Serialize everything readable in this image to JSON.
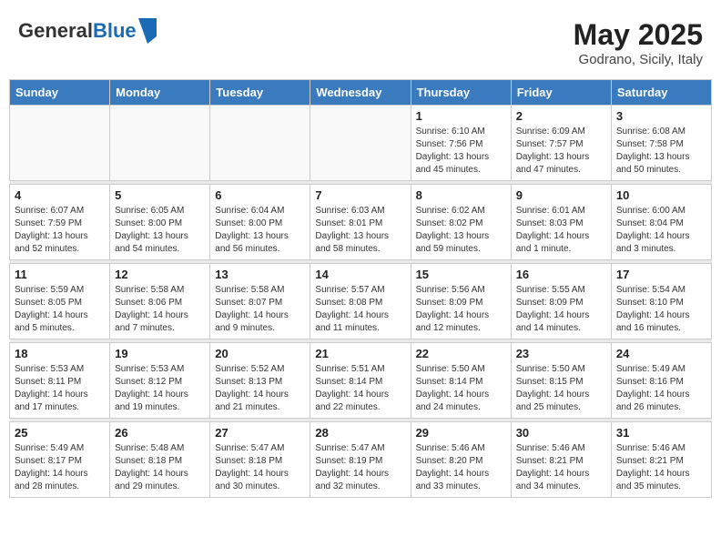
{
  "header": {
    "logo_general": "General",
    "logo_blue": "Blue",
    "month_title": "May 2025",
    "subtitle": "Godrano, Sicily, Italy"
  },
  "weekdays": [
    "Sunday",
    "Monday",
    "Tuesday",
    "Wednesday",
    "Thursday",
    "Friday",
    "Saturday"
  ],
  "weeks": [
    [
      {
        "day": "",
        "info": ""
      },
      {
        "day": "",
        "info": ""
      },
      {
        "day": "",
        "info": ""
      },
      {
        "day": "",
        "info": ""
      },
      {
        "day": "1",
        "info": "Sunrise: 6:10 AM\nSunset: 7:56 PM\nDaylight: 13 hours\nand 45 minutes."
      },
      {
        "day": "2",
        "info": "Sunrise: 6:09 AM\nSunset: 7:57 PM\nDaylight: 13 hours\nand 47 minutes."
      },
      {
        "day": "3",
        "info": "Sunrise: 6:08 AM\nSunset: 7:58 PM\nDaylight: 13 hours\nand 50 minutes."
      }
    ],
    [
      {
        "day": "4",
        "info": "Sunrise: 6:07 AM\nSunset: 7:59 PM\nDaylight: 13 hours\nand 52 minutes."
      },
      {
        "day": "5",
        "info": "Sunrise: 6:05 AM\nSunset: 8:00 PM\nDaylight: 13 hours\nand 54 minutes."
      },
      {
        "day": "6",
        "info": "Sunrise: 6:04 AM\nSunset: 8:00 PM\nDaylight: 13 hours\nand 56 minutes."
      },
      {
        "day": "7",
        "info": "Sunrise: 6:03 AM\nSunset: 8:01 PM\nDaylight: 13 hours\nand 58 minutes."
      },
      {
        "day": "8",
        "info": "Sunrise: 6:02 AM\nSunset: 8:02 PM\nDaylight: 13 hours\nand 59 minutes."
      },
      {
        "day": "9",
        "info": "Sunrise: 6:01 AM\nSunset: 8:03 PM\nDaylight: 14 hours\nand 1 minute."
      },
      {
        "day": "10",
        "info": "Sunrise: 6:00 AM\nSunset: 8:04 PM\nDaylight: 14 hours\nand 3 minutes."
      }
    ],
    [
      {
        "day": "11",
        "info": "Sunrise: 5:59 AM\nSunset: 8:05 PM\nDaylight: 14 hours\nand 5 minutes."
      },
      {
        "day": "12",
        "info": "Sunrise: 5:58 AM\nSunset: 8:06 PM\nDaylight: 14 hours\nand 7 minutes."
      },
      {
        "day": "13",
        "info": "Sunrise: 5:58 AM\nSunset: 8:07 PM\nDaylight: 14 hours\nand 9 minutes."
      },
      {
        "day": "14",
        "info": "Sunrise: 5:57 AM\nSunset: 8:08 PM\nDaylight: 14 hours\nand 11 minutes."
      },
      {
        "day": "15",
        "info": "Sunrise: 5:56 AM\nSunset: 8:09 PM\nDaylight: 14 hours\nand 12 minutes."
      },
      {
        "day": "16",
        "info": "Sunrise: 5:55 AM\nSunset: 8:09 PM\nDaylight: 14 hours\nand 14 minutes."
      },
      {
        "day": "17",
        "info": "Sunrise: 5:54 AM\nSunset: 8:10 PM\nDaylight: 14 hours\nand 16 minutes."
      }
    ],
    [
      {
        "day": "18",
        "info": "Sunrise: 5:53 AM\nSunset: 8:11 PM\nDaylight: 14 hours\nand 17 minutes."
      },
      {
        "day": "19",
        "info": "Sunrise: 5:53 AM\nSunset: 8:12 PM\nDaylight: 14 hours\nand 19 minutes."
      },
      {
        "day": "20",
        "info": "Sunrise: 5:52 AM\nSunset: 8:13 PM\nDaylight: 14 hours\nand 21 minutes."
      },
      {
        "day": "21",
        "info": "Sunrise: 5:51 AM\nSunset: 8:14 PM\nDaylight: 14 hours\nand 22 minutes."
      },
      {
        "day": "22",
        "info": "Sunrise: 5:50 AM\nSunset: 8:14 PM\nDaylight: 14 hours\nand 24 minutes."
      },
      {
        "day": "23",
        "info": "Sunrise: 5:50 AM\nSunset: 8:15 PM\nDaylight: 14 hours\nand 25 minutes."
      },
      {
        "day": "24",
        "info": "Sunrise: 5:49 AM\nSunset: 8:16 PM\nDaylight: 14 hours\nand 26 minutes."
      }
    ],
    [
      {
        "day": "25",
        "info": "Sunrise: 5:49 AM\nSunset: 8:17 PM\nDaylight: 14 hours\nand 28 minutes."
      },
      {
        "day": "26",
        "info": "Sunrise: 5:48 AM\nSunset: 8:18 PM\nDaylight: 14 hours\nand 29 minutes."
      },
      {
        "day": "27",
        "info": "Sunrise: 5:47 AM\nSunset: 8:18 PM\nDaylight: 14 hours\nand 30 minutes."
      },
      {
        "day": "28",
        "info": "Sunrise: 5:47 AM\nSunset: 8:19 PM\nDaylight: 14 hours\nand 32 minutes."
      },
      {
        "day": "29",
        "info": "Sunrise: 5:46 AM\nSunset: 8:20 PM\nDaylight: 14 hours\nand 33 minutes."
      },
      {
        "day": "30",
        "info": "Sunrise: 5:46 AM\nSunset: 8:21 PM\nDaylight: 14 hours\nand 34 minutes."
      },
      {
        "day": "31",
        "info": "Sunrise: 5:46 AM\nSunset: 8:21 PM\nDaylight: 14 hours\nand 35 minutes."
      }
    ]
  ]
}
